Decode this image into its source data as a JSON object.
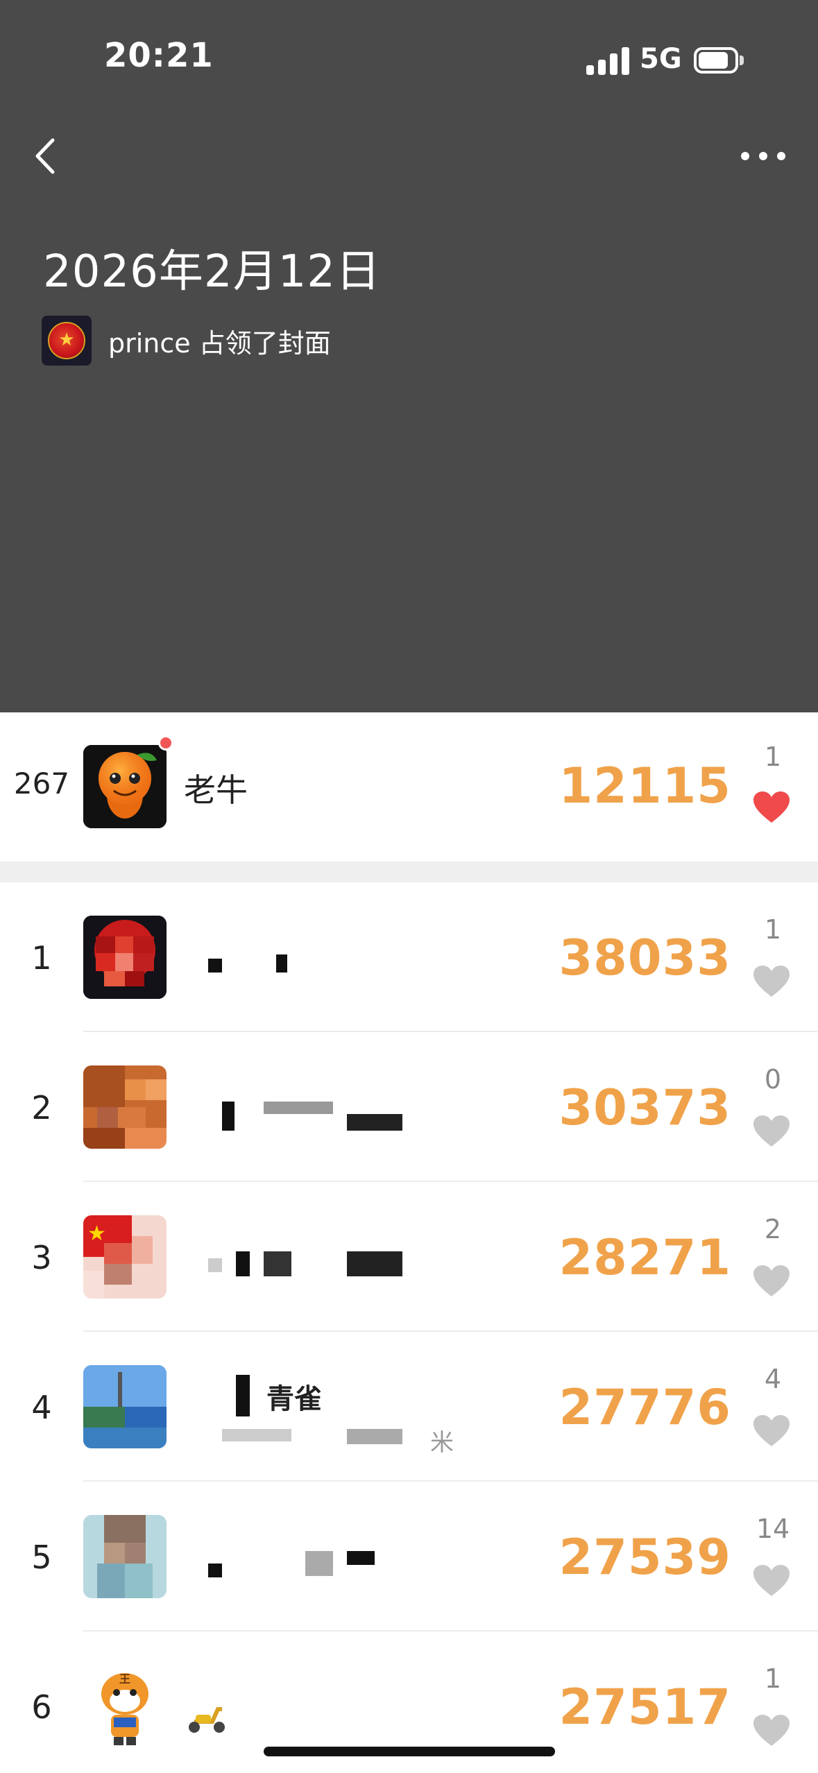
{
  "status_bar": {
    "time": "20:21",
    "network": "5G"
  },
  "header": {
    "date_title": "2026年2月12日",
    "cover_text": "prince 占领了封面",
    "icons": {
      "back": "chevron-left-icon",
      "more": "ellipsis-icon"
    }
  },
  "self_entry": {
    "rank": "267",
    "name": "老牛",
    "steps": "12115",
    "likes": "1",
    "liked": true
  },
  "ranking": [
    {
      "rank": "1",
      "name": "",
      "steps": "38033",
      "likes": "1"
    },
    {
      "rank": "2",
      "name": "",
      "steps": "30373",
      "likes": "0"
    },
    {
      "rank": "3",
      "name": "",
      "steps": "28271",
      "likes": "2"
    },
    {
      "rank": "4",
      "name": "青雀",
      "subtitle": "米",
      "steps": "27776",
      "likes": "4"
    },
    {
      "rank": "5",
      "name": "",
      "steps": "27539",
      "likes": "14"
    },
    {
      "rank": "6",
      "name": "",
      "steps": "27517",
      "likes": "1"
    }
  ],
  "colors": {
    "header_bg": "#4a4a4a",
    "steps": "#f0a24a",
    "heart_active": "#f04a4a",
    "heart_inactive": "#c8c8c8"
  }
}
